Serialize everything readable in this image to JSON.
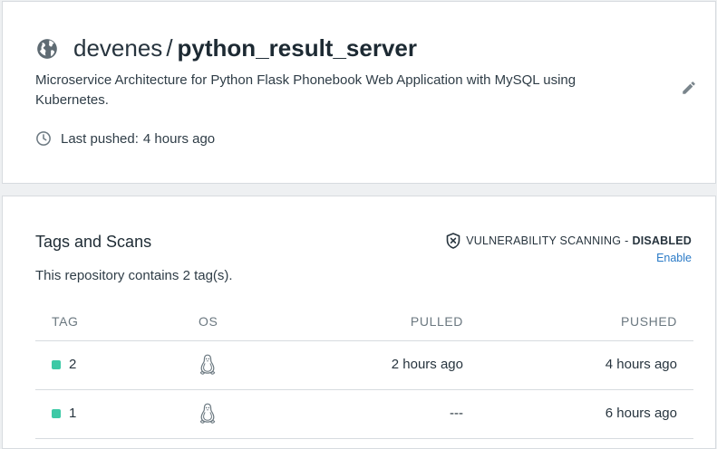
{
  "repo": {
    "namespace": "devenes",
    "separator": "/",
    "name": "python_result_server",
    "description": "Microservice Architecture for Python Flask Phonebook Web Application with MySQL using Kubernetes.",
    "last_pushed_label": "Last pushed:",
    "last_pushed_value": "4 hours ago",
    "icons": {
      "visibility": "globe-icon",
      "edit": "pencil-icon",
      "time": "clock-icon"
    }
  },
  "tags": {
    "title": "Tags and Scans",
    "vulnerability_label": "VULNERABILITY SCANNING",
    "vulnerability_separator": "-",
    "vulnerability_status": "DISABLED",
    "enable_label": "Enable",
    "count_text": "This repository contains 2 tag(s).",
    "columns": {
      "tag": "TAG",
      "os": "OS",
      "pulled": "PULLED",
      "pushed": "PUSHED"
    },
    "rows": [
      {
        "tag": "2",
        "os": "linux-icon",
        "pulled": "2 hours ago",
        "pushed": "4 hours ago"
      },
      {
        "tag": "1",
        "os": "linux-icon",
        "pulled": "---",
        "pushed": "6 hours ago"
      }
    ]
  },
  "colors": {
    "background": "#eef0f2",
    "card": "#ffffff",
    "border": "#d7dbdf",
    "text": "#27343e",
    "muted": "#6b7880",
    "link": "#2b7bc7",
    "tag_dot": "#3dc9a6"
  }
}
